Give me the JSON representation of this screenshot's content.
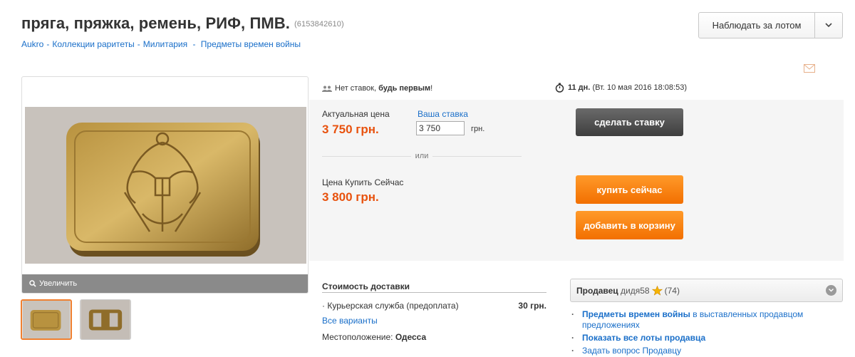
{
  "header": {
    "title": "пряга, пряжка, ремень, РИФ, ПМВ.",
    "lot_id": "(6153842610)",
    "watch_label": "Наблюдать за лотом"
  },
  "breadcrumb": [
    "Aukro",
    "Коллекции раритеты",
    "Милитария",
    "Предметы времен войны"
  ],
  "gallery": {
    "zoom_label": "Увеличить"
  },
  "bids": {
    "no_bids": "Нет ставок,",
    "be_first": "будь первым",
    "excl": "!",
    "time_left": "11 дн.",
    "end_date": "(Вт. 10 мая 2016 18:08:53)"
  },
  "price": {
    "current_label": "Актуальная цена",
    "current_value": "3 750 грн.",
    "your_bid_label": "Ваша ставка",
    "your_bid_value": "3 750",
    "currency": "грн.",
    "or": "или",
    "buy_now_label": "Цена Купить Сейчас",
    "buy_now_value": "3 800 грн.",
    "bid_button": "сделать ставку",
    "buy_button": "купить сейчас",
    "cart_button": "добавить в корзину"
  },
  "shipping": {
    "title": "Стоимость доставки",
    "method": "Курьерская служба (предоплата)",
    "cost": "30 грн.",
    "all_variants": "Все варианты",
    "location_label": "Местоположение:",
    "location_value": "Одесса"
  },
  "seller": {
    "label": "Продавец",
    "name": "дидя58",
    "rating": "(74)",
    "link1_strong": "Предметы времен войны",
    "link1_rest": "в выставленных продавцом предложениях",
    "link2": "Показать все лоты продавца",
    "link3": "Задать вопрос Продавцу"
  },
  "colors": {
    "accent_orange": "#f26f00",
    "price_red": "#e8520e",
    "link_blue": "#1a6fc9"
  }
}
